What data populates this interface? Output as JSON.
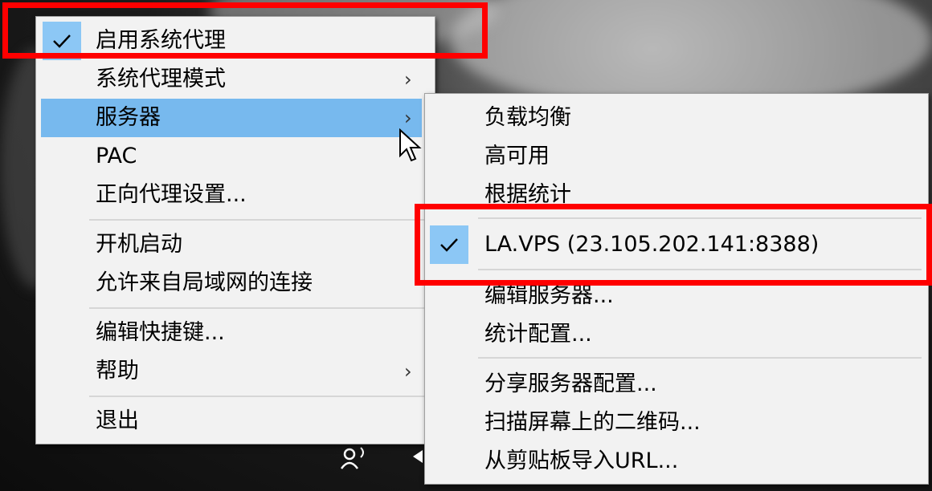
{
  "main_menu": {
    "items": [
      {
        "label": "启用系统代理",
        "checked": true
      },
      {
        "label": "系统代理模式",
        "submenu": true
      },
      {
        "label": "服务器",
        "submenu": true,
        "highlighted": true
      },
      {
        "label": "PAC"
      },
      {
        "label": "正向代理设置..."
      },
      {
        "label": "开机启动"
      },
      {
        "label": "允许来自局域网的连接"
      },
      {
        "label": "编辑快捷键..."
      },
      {
        "label": "帮助",
        "submenu": true
      },
      {
        "label": "退出"
      }
    ]
  },
  "server_submenu": {
    "items": [
      {
        "label": "负载均衡"
      },
      {
        "label": "高可用"
      },
      {
        "label": "根据统计"
      },
      {
        "label": "LA.VPS (23.105.202.141:8388)",
        "checked": true
      },
      {
        "label": "编辑服务器..."
      },
      {
        "label": "统计配置..."
      },
      {
        "label": "分享服务器配置..."
      },
      {
        "label": "扫描屏幕上的二维码..."
      },
      {
        "label": "从剪贴板导入URL..."
      }
    ]
  },
  "colors": {
    "highlight": "#77b9ee",
    "check_box": "#8cc7f5",
    "annotation": "#ff0000",
    "menu_bg": "#f2f2f2"
  },
  "icons": {
    "submenu_arrow": "›",
    "check": "check-icon",
    "cursor": "mouse-cursor-icon",
    "tray": "tray-person-icon"
  }
}
